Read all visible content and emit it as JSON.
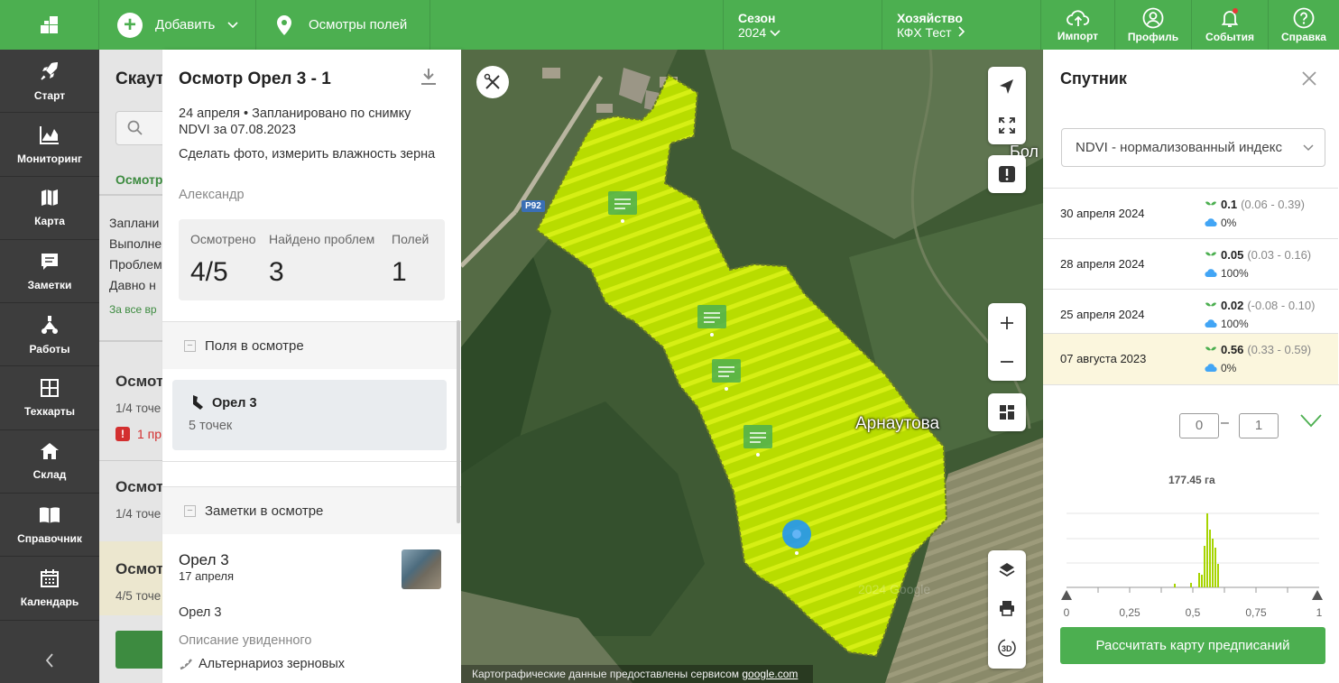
{
  "topbar": {
    "add_label": "Добавить",
    "inspections_label": "Осмотры полей",
    "season_label": "Сезон",
    "season_value": "2024",
    "farm_label": "Хозяйство",
    "farm_value": "КФХ Тест",
    "import_label": "Импорт",
    "profile_label": "Профиль",
    "events_label": "События",
    "help_label": "Справка"
  },
  "sidebar": {
    "items": [
      {
        "label": "Старт",
        "icon": "rocket-icon"
      },
      {
        "label": "Мониторинг",
        "icon": "chart-icon"
      },
      {
        "label": "Карта",
        "icon": "map-icon"
      },
      {
        "label": "Заметки",
        "icon": "notes-icon"
      },
      {
        "label": "Работы",
        "icon": "tractor-icon"
      },
      {
        "label": "Техкарты",
        "icon": "grid-icon"
      },
      {
        "label": "Склад",
        "icon": "warehouse-icon"
      },
      {
        "label": "Справочник",
        "icon": "book-icon"
      },
      {
        "label": "Календарь",
        "icon": "calendar-icon"
      }
    ]
  },
  "bg_list": {
    "title": "Скаут",
    "tab": "Осмотр",
    "filters": [
      "Заплани",
      "Выполне",
      "Проблем",
      "Давно н"
    ],
    "all_time": "За все вр",
    "items": [
      {
        "title": "Осмот",
        "sub": "1/4 точе",
        "problem": "1 пр"
      },
      {
        "title": "Осмот",
        "sub": "1/4 точе"
      },
      {
        "title": "Осмот",
        "sub": "4/5 точе"
      }
    ]
  },
  "panel": {
    "title": "Осмотр Орел 3 - 1",
    "meta": "24 апреля • Запланировано по снимку NDVI за 07.08.2023",
    "task": "Сделать фото, измерить влажность зерна",
    "author": "Александр",
    "stats": [
      {
        "label": "Осмотрено",
        "value": "4/5"
      },
      {
        "label": "Найдено проблем",
        "value": "3"
      },
      {
        "label": "Полей",
        "value": "1"
      }
    ],
    "fields_section": "Поля в осмотре",
    "field": {
      "name": "Орел 3",
      "points": "5 точек"
    },
    "notes_section": "Заметки в осмотре",
    "note": {
      "title": "Орел 3",
      "date": "17 апреля",
      "field": "Орел 3",
      "desc_label": "Описание увиденного",
      "disease": "Альтернариоз зерновых"
    }
  },
  "map": {
    "village": "Арнаутова",
    "village2": "Бол",
    "road": "Р92",
    "watermark": "2024 Google",
    "attribution_prefix": "Картографические данные предоставлены сервисом ",
    "attribution_link": "google.com"
  },
  "satellite": {
    "title": "Спутник",
    "index_select": "NDVI - нормализованный индекс",
    "dates": [
      {
        "date": "30 апреля 2024",
        "ndvi": "0.1",
        "range": "(0.06 - 0.39)",
        "cloud": "0%"
      },
      {
        "date": "28 апреля 2024",
        "ndvi": "0.05",
        "range": "(0.03 - 0.16)",
        "cloud": "100%"
      },
      {
        "date": "25 апреля 2024",
        "ndvi": "0.02",
        "range": "(-0.08 - 0.10)",
        "cloud": "100%"
      },
      {
        "date": "07 августа 2023",
        "ndvi": "0.56",
        "range": "(0.33 - 0.59)",
        "cloud": "0%"
      }
    ],
    "range_min": "0",
    "range_max": "1",
    "area": "177.45 га",
    "axis_labels": [
      "0",
      "0,25",
      "0,5",
      "0,75",
      "1"
    ],
    "calc_button": "Рассчитать карту предписаний"
  },
  "colors": {
    "brand": "#4caf50",
    "sidebar": "#3d3d3d",
    "selected_row": "#fbf6dd",
    "field": "#c7e600"
  }
}
